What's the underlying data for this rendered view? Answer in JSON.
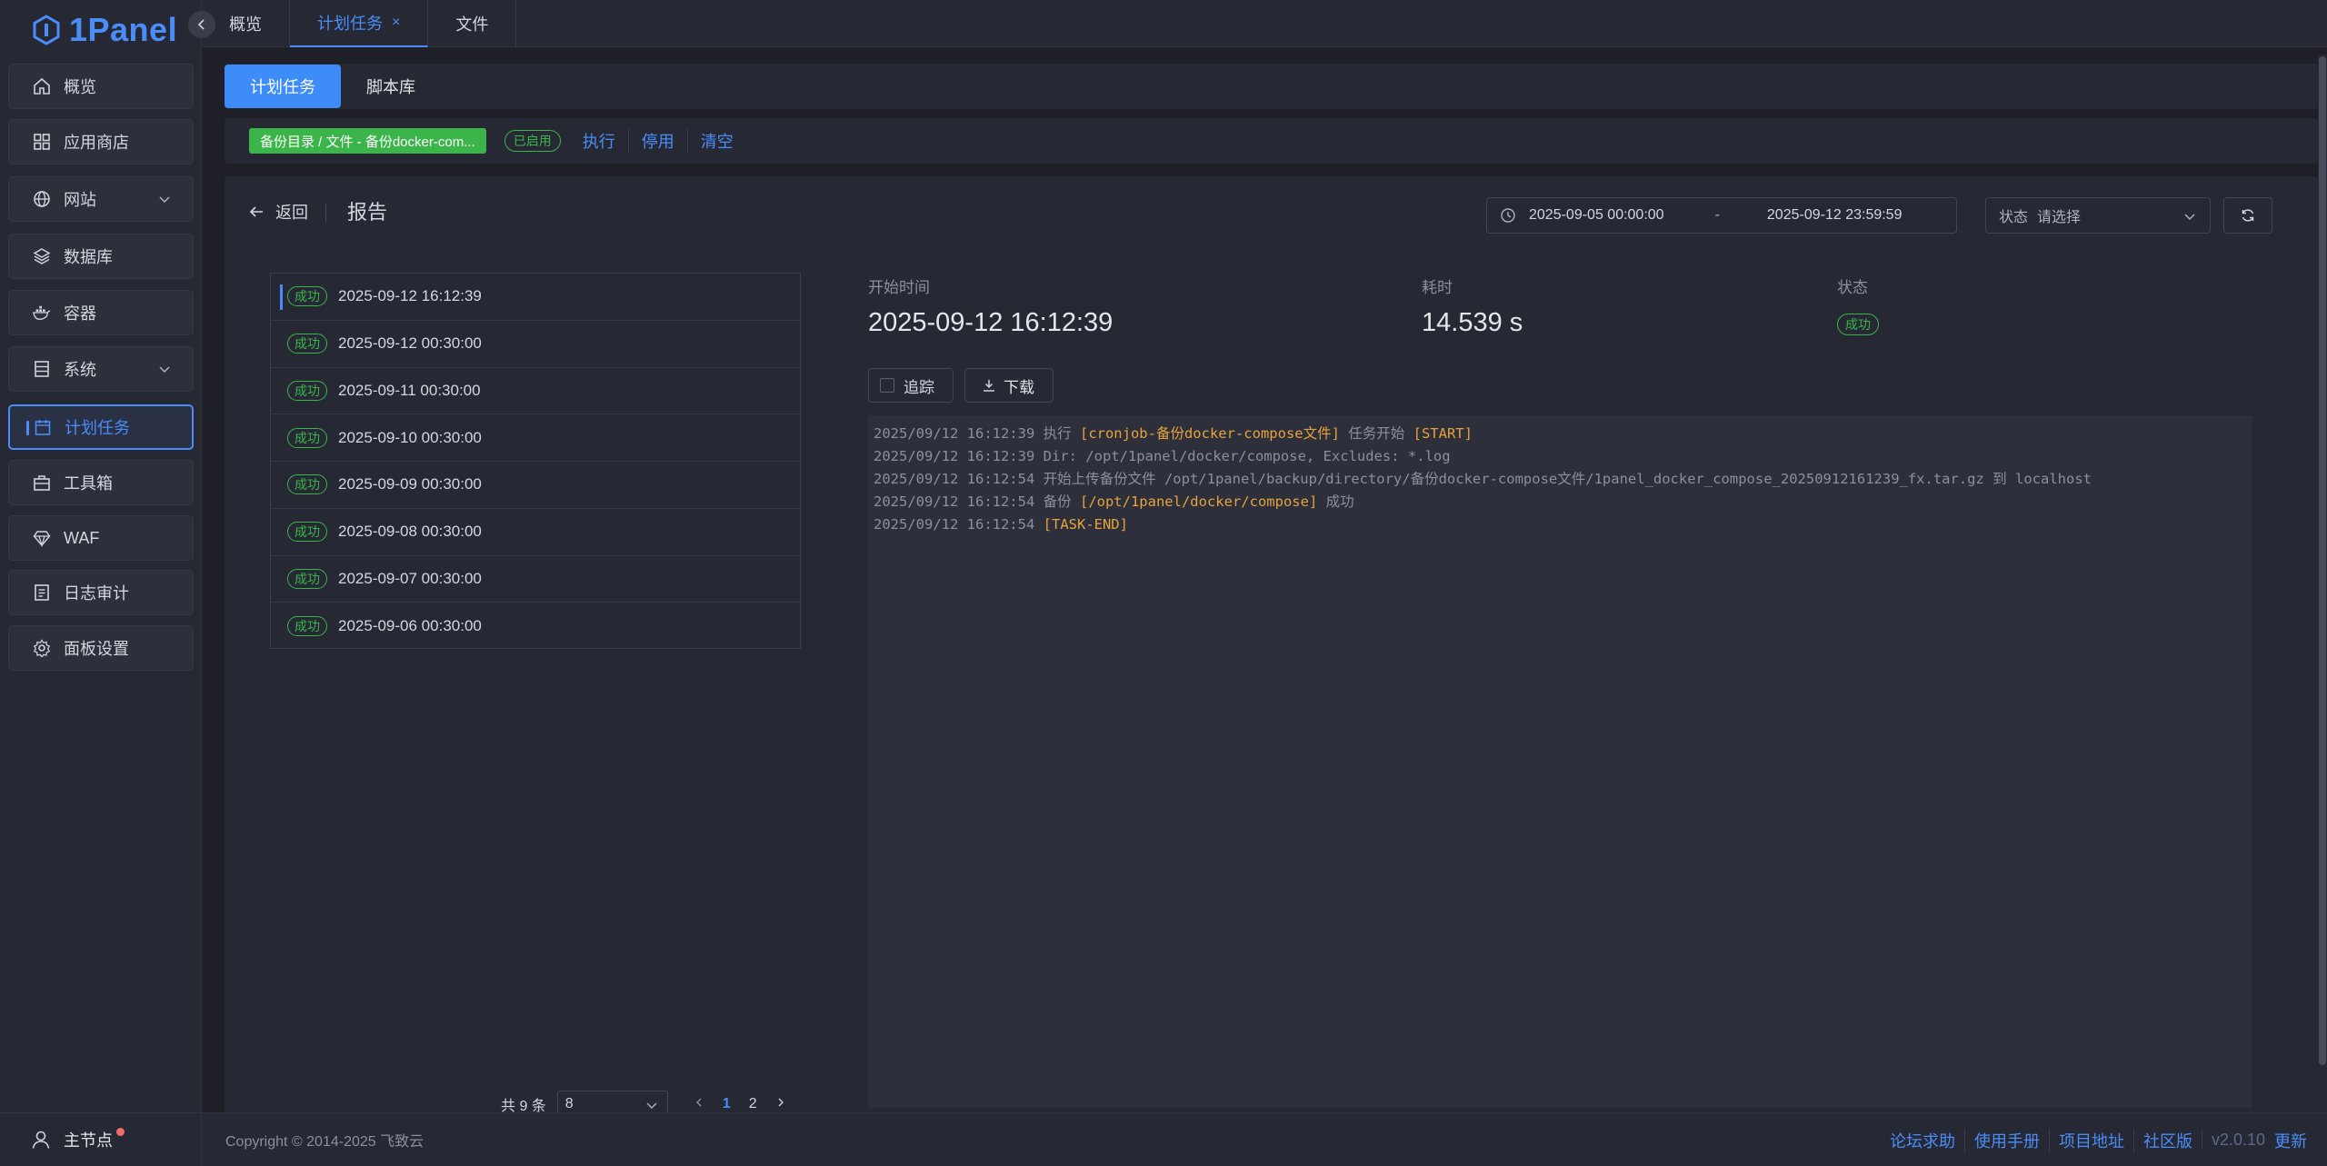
{
  "app": {
    "logo_text": "1Panel"
  },
  "sidebar": {
    "items": [
      {
        "label": "概览",
        "icon": "home-icon"
      },
      {
        "label": "应用商店",
        "icon": "apps-grid-icon"
      },
      {
        "label": "网站",
        "icon": "globe-icon"
      },
      {
        "label": "数据库",
        "icon": "layers-icon"
      },
      {
        "label": "容器",
        "icon": "docker-icon"
      },
      {
        "label": "系统",
        "icon": "server-icon"
      },
      {
        "label": "计划任务",
        "icon": "calendar-icon"
      },
      {
        "label": "工具箱",
        "icon": "toolbox-icon"
      },
      {
        "label": "WAF",
        "icon": "diamond-icon"
      },
      {
        "label": "日志审计",
        "icon": "log-icon"
      },
      {
        "label": "面板设置",
        "icon": "gear-icon"
      }
    ],
    "node_label": "主节点"
  },
  "tabs": [
    {
      "label": "概览"
    },
    {
      "label": "计划任务",
      "close": "×"
    },
    {
      "label": "文件"
    }
  ],
  "subtabs": [
    {
      "label": "计划任务"
    },
    {
      "label": "脚本库"
    }
  ],
  "task": {
    "name": "备份目录 / 文件 - 备份docker-com...",
    "status": "已启用",
    "actions": [
      "执行",
      "停用",
      "清空"
    ]
  },
  "report": {
    "back_label": "返回",
    "title": "报告",
    "date_start": "2025-09-05 00:00:00",
    "date_sep": "-",
    "date_end": "2025-09-12 23:59:59",
    "status_label": "状态",
    "status_placeholder": "请选择"
  },
  "records": [
    {
      "badge": "成功",
      "time": "2025-09-12 16:12:39"
    },
    {
      "badge": "成功",
      "time": "2025-09-12 00:30:00"
    },
    {
      "badge": "成功",
      "time": "2025-09-11 00:30:00"
    },
    {
      "badge": "成功",
      "time": "2025-09-10 00:30:00"
    },
    {
      "badge": "成功",
      "time": "2025-09-09 00:30:00"
    },
    {
      "badge": "成功",
      "time": "2025-09-08 00:30:00"
    },
    {
      "badge": "成功",
      "time": "2025-09-07 00:30:00"
    },
    {
      "badge": "成功",
      "time": "2025-09-06 00:30:00"
    }
  ],
  "pagination": {
    "total": "共 9 条",
    "page_size": "8",
    "pages": [
      "1",
      "2"
    ],
    "current": "1"
  },
  "detail": {
    "start_label": "开始时间",
    "start_value": "2025-09-12 16:12:39",
    "duration_label": "耗时",
    "duration_value": "14.539 s",
    "status_label": "状态",
    "status_value": "成功",
    "follow_label": "追踪",
    "download_label": "下载"
  },
  "log": {
    "lines": [
      {
        "ts": "2025/09/12 16:12:39",
        "a": " 执行 ",
        "h1": "[cronjob-备份docker-compose文件]",
        "b": " 任务开始 ",
        "h2": "[START]"
      },
      {
        "ts": "2025/09/12 16:12:39",
        "a": " Dir: /opt/1panel/docker/compose, Excludes: *.log",
        "h1": "",
        "b": "",
        "h2": ""
      },
      {
        "ts": "2025/09/12 16:12:54",
        "a": " 开始上传备份文件 /opt/1panel/backup/directory/备份docker-compose文件/1panel_docker_compose_20250912161239_fx.tar.gz 到 localhost",
        "h1": "",
        "b": "",
        "h2": ""
      },
      {
        "ts": "2025/09/12 16:12:54",
        "a": " 备份 ",
        "h1": "[/opt/1panel/docker/compose]",
        "b": " 成功",
        "h2": ""
      },
      {
        "ts": "2025/09/12 16:12:54",
        "a": " ",
        "h1": "[TASK-END]",
        "b": "",
        "h2": ""
      }
    ]
  },
  "footer": {
    "copyright": "Copyright © 2014-2025 飞致云",
    "links": [
      "论坛求助",
      "使用手册",
      "项目地址",
      "社区版"
    ],
    "version": "v2.0.10",
    "update": "更新"
  },
  "colors": {
    "accent": "#4a8df8",
    "success": "#3bb54a",
    "highlight": "#e6a23c"
  }
}
